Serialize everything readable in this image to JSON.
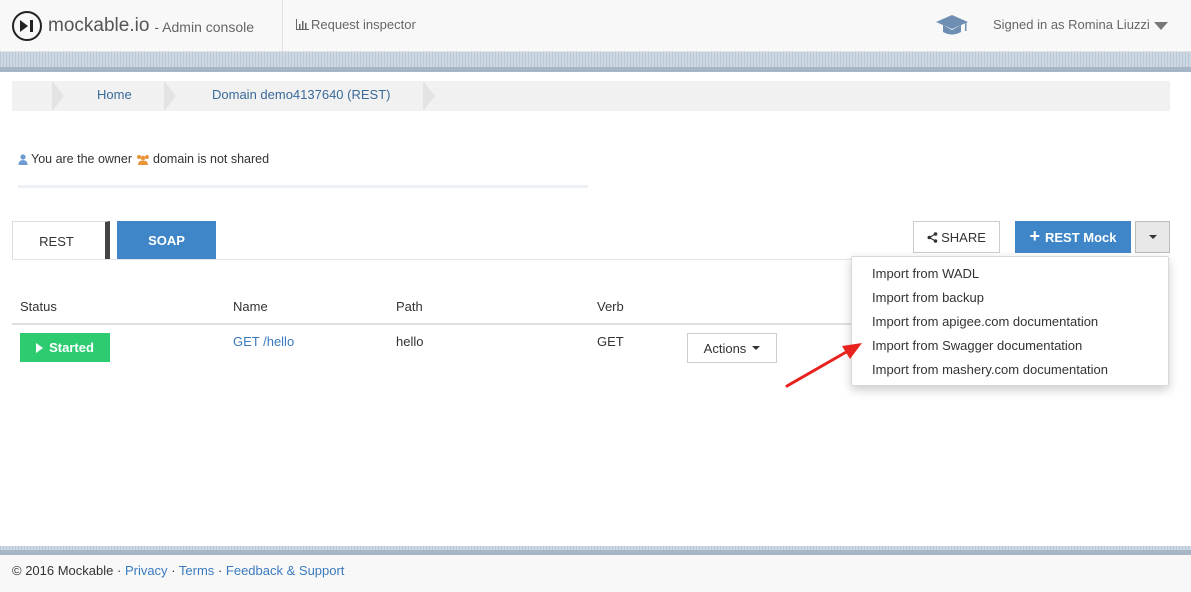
{
  "header": {
    "brand": "mockable.io",
    "brand_sub": "- Admin console",
    "request_inspector": "Request inspector",
    "signed_in": "Signed in as Romina Liuzzi"
  },
  "breadcrumb": {
    "home": "Home",
    "domain": "Domain demo4137640 (REST)"
  },
  "ownership": {
    "owner_text": "You are the owner",
    "shared_text": "domain is not shared"
  },
  "tabs": {
    "rest": "REST",
    "soap": "SOAP"
  },
  "toolbar": {
    "share": "SHARE",
    "rest_mock": "REST Mock"
  },
  "table": {
    "headers": [
      "Status",
      "Name",
      "Path",
      "Verb"
    ],
    "rows": [
      {
        "status": "Started",
        "name": "GET /hello",
        "path": "hello",
        "verb": "GET",
        "actions": "Actions"
      }
    ]
  },
  "dropdown": {
    "items": [
      "Import from WADL",
      "Import from backup",
      "Import from apigee.com documentation",
      "Import from Swagger documentation",
      "Import from mashery.com documentation"
    ]
  },
  "footer": {
    "copyright": "© 2016 Mockable ·",
    "privacy": "Privacy",
    "sep1": "·",
    "terms": "Terms",
    "sep2": "·",
    "feedback": "Feedback & Support"
  },
  "colors": {
    "accent": "#3f86c8",
    "success": "#2ecc71",
    "link": "#3a7abf",
    "annotation_arrow": "#e8231f"
  }
}
